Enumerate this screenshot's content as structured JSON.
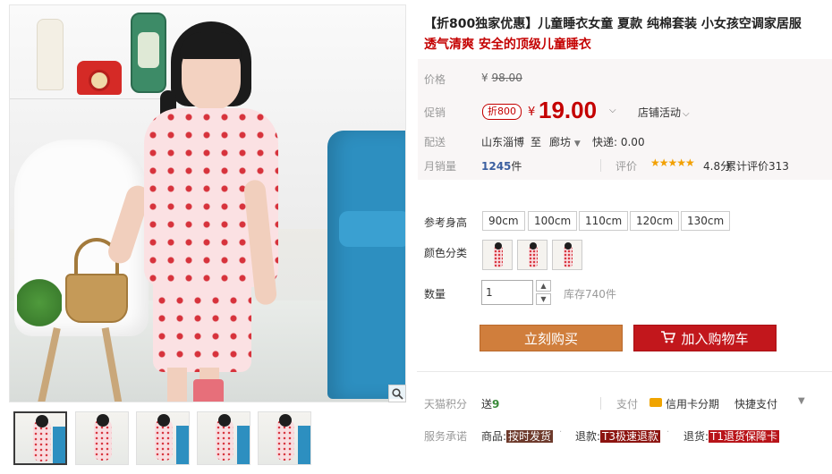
{
  "product": {
    "title": "【折800独家优惠】儿童睡衣女童 夏款 纯棉套装 小女孩空调家居服",
    "subtitle": "透气清爽 安全的顶级儿童睡衣"
  },
  "price": {
    "label": "价格",
    "original_symbol": "¥",
    "original_value": "98.00",
    "promo_label": "促销",
    "promo_badge": "折800",
    "current_symbol": "¥",
    "current_value": "19.00",
    "store_promo": "店铺活动"
  },
  "shipping": {
    "label": "配送",
    "from": "山东淄博",
    "to_word": "至",
    "to_city": "廊坊",
    "fee": "快递: 0.00"
  },
  "sales": {
    "label": "月销量",
    "count": "1245",
    "unit": "件",
    "rating_label": "评价",
    "stars": "★★★★★",
    "rating": "4.8分",
    "review_count": "累计评价313"
  },
  "size": {
    "label": "参考身高",
    "options": [
      "90cm",
      "100cm",
      "110cm",
      "120cm",
      "130cm"
    ]
  },
  "color": {
    "label": "颜色分类"
  },
  "quantity": {
    "label": "数量",
    "value": "1",
    "stock": "库存740件"
  },
  "actions": {
    "buy_now": "立刻购买",
    "add_to_cart": "加入购物车"
  },
  "points": {
    "label": "天猫积分",
    "prefix": "送",
    "value": "9"
  },
  "payment": {
    "label": "支付",
    "card": "信用卡分期",
    "quick": "快捷支付"
  },
  "service": {
    "label": "服务承诺",
    "item1_prefix": "商品:",
    "item1_tag": "按时发货",
    "item2_prefix": "退款:",
    "item2_tag": "T3极速退款",
    "item3_prefix": "退货:",
    "item3_tag": "T1退货保障卡"
  },
  "icons": {
    "zoom": "magnifier-icon",
    "cart": "cart-icon",
    "card": "credit-card-icon"
  },
  "colors": {
    "accent_red": "#c40000",
    "buy_orange": "#d07e3c",
    "cart_red": "#c2171c",
    "star_gold": "#f2a000"
  }
}
